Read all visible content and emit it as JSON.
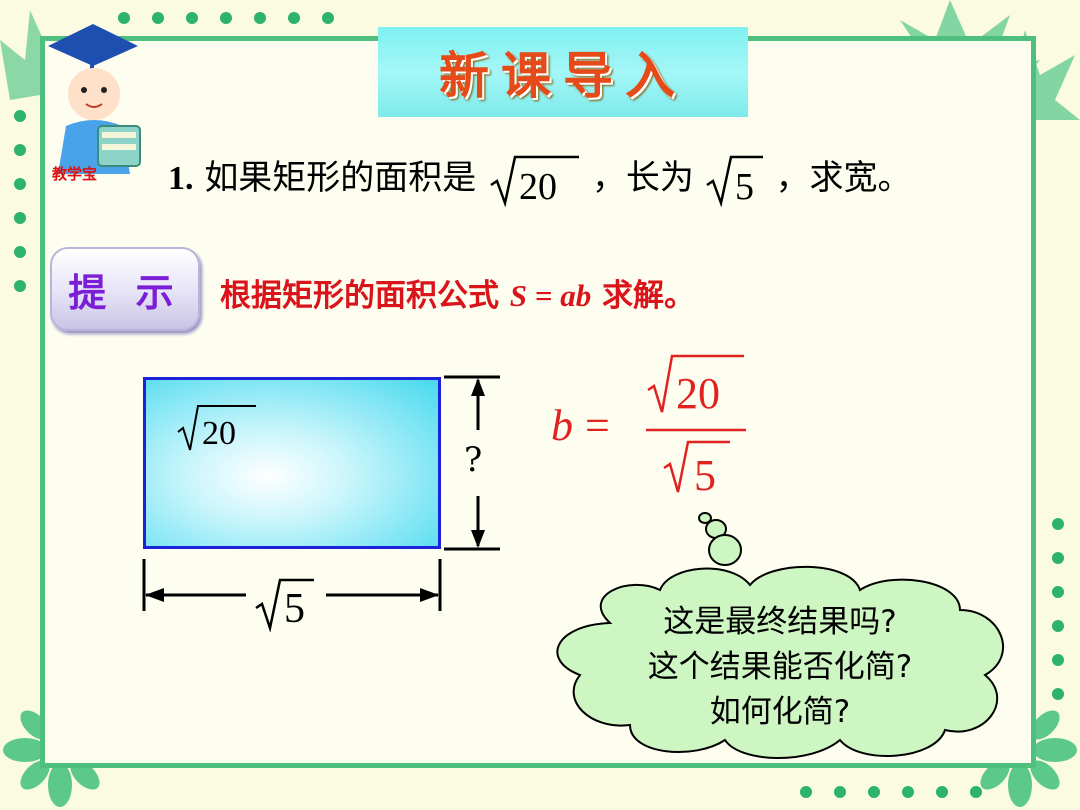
{
  "title": "新课导入",
  "logo": {
    "caption": "教学宝",
    "icon": "teacher-icon"
  },
  "question": {
    "number": "1.",
    "text_a": "如果矩形的面积是",
    "area_radicand": "20",
    "text_b": "，长为",
    "length_radicand": "5",
    "text_c": "，求宽。"
  },
  "hint": {
    "label": "提 示",
    "text_a": "根据矩形的面积公式 ",
    "formula": "S = ab",
    "text_b": " 求解。"
  },
  "diagram": {
    "area_radicand": "20",
    "length_radicand": "5",
    "width_unknown": "?"
  },
  "equation": {
    "var": "b",
    "eq": "=",
    "numerator_radicand": "20",
    "denominator_radicand": "5"
  },
  "thought": {
    "lines": [
      "这是最终结果吗?",
      "这个结果能否化简?",
      "如何化简?"
    ]
  },
  "colors": {
    "title": "#e64a19",
    "hint_text": "#d9141b",
    "hint_label": "#7a1fd6",
    "rect_border": "#1d22d8",
    "cloud": "#cdf6c3",
    "frame": "#4fbf7d"
  }
}
